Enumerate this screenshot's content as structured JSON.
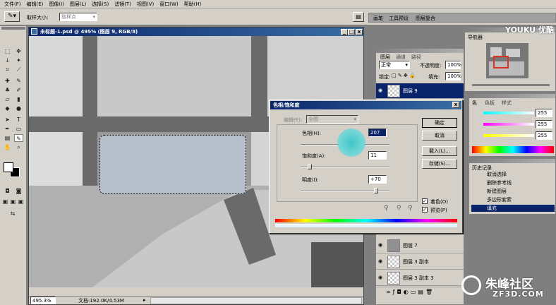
{
  "menubar": [
    "文件(F)",
    "编辑(E)",
    "图像(I)",
    "图层(L)",
    "选择(S)",
    "滤镜(T)",
    "视图(V)",
    "窗口(W)",
    "帮助(H)"
  ],
  "options": {
    "sample_label": "取样大小:",
    "sample_value": "取样点"
  },
  "top_tabs": [
    "画笔",
    "工具预设",
    "图层复合"
  ],
  "document": {
    "title": "未标题-1.psd @ 495% (图层 9, RGB/8)",
    "zoom": "495.3%",
    "doc_info": "文档:192.0K/4.53M"
  },
  "navigator": {
    "tab": "导航器"
  },
  "layers": {
    "tabs": [
      "图层",
      "通道",
      "路径"
    ],
    "mode": "正常",
    "opacity_label": "不透明度:",
    "opacity": "100%",
    "lock_label": "锁定:",
    "fill_label": "填充:",
    "fill": "100%",
    "top_layer": "图层 9",
    "bottom_layers": [
      "图层 7",
      "图层 3 副本",
      "图层 3 副本 3"
    ]
  },
  "color_panel": {
    "tabs": [
      "色",
      "色板",
      "样式"
    ],
    "values": [
      "255",
      "255",
      "255"
    ]
  },
  "history": {
    "tab": "历史记录",
    "items": [
      "取消选择",
      "删除参考线",
      "新建图层",
      "多边形套索",
      "填充"
    ]
  },
  "dialog": {
    "title": "色相/饱和度",
    "edit_label": "编辑(E):",
    "edit_value": "全图",
    "hue_label": "色相(H):",
    "hue_value": "207",
    "sat_label": "饱和度(A):",
    "sat_value": "11",
    "light_label": "明度(I):",
    "light_value": "+70",
    "buttons": {
      "ok": "确定",
      "cancel": "取消",
      "load": "载入(L)...",
      "save": "存储(S)..."
    },
    "colorize_label": "着色(O)",
    "preview_label": "预览(P)",
    "hue_position": 0.575,
    "sat_position": 0.1,
    "light_position": 0.85
  },
  "watermarks": {
    "youku": "YOUKU 优酷",
    "zf3d_cn": "朱峰社区",
    "zf3d_en": "ZF3D.COM"
  }
}
